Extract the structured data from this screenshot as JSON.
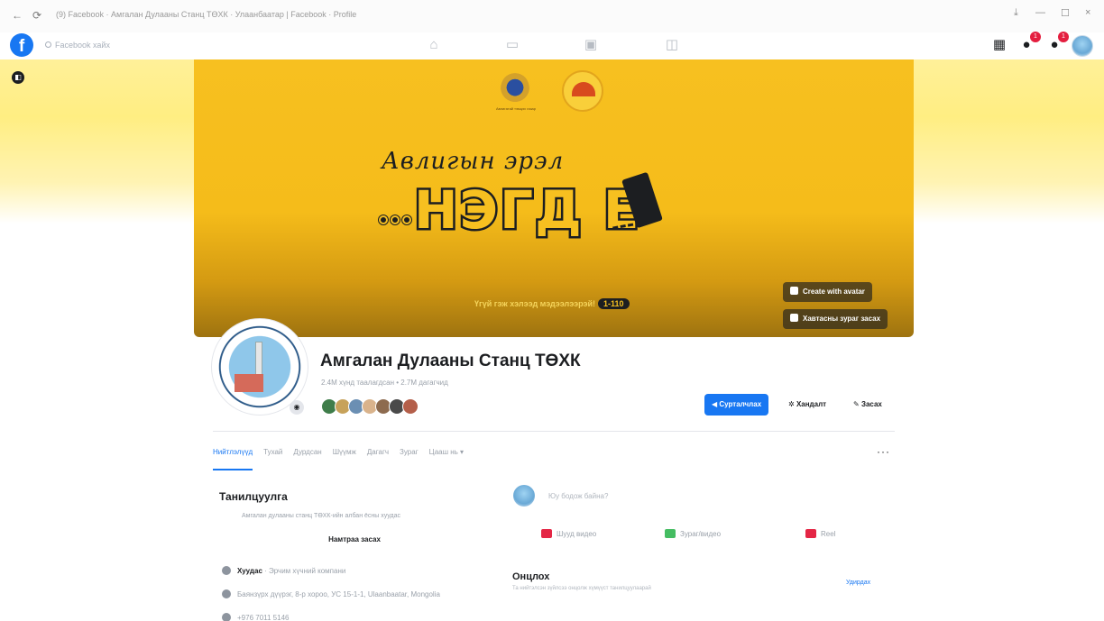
{
  "browser": {
    "back": "←",
    "reload": "⟳",
    "tab_title": "(9) Facebook · Амгалан Дулааны Станц ТӨХК · Улаанбаатар | Facebook · Profile",
    "win_download": "⤓",
    "win_min": "—",
    "win_max": "☐",
    "win_close": "×"
  },
  "topnav": {
    "logo": "f",
    "search_placeholder": "Facebook хайх",
    "nav_icons": [
      "home-icon",
      "video-icon",
      "marketplace-icon",
      "groups-icon"
    ],
    "menu_glyph": "▦",
    "messenger_badge": "1",
    "notifications_badge": "1"
  },
  "cover": {
    "toggle_glyph": "◧",
    "emblem_caption": "Авлигатай тэмцэх газар",
    "script_line": "Авлигын эрэл",
    "big_word": "НЭГД E",
    "hotline_text": "Үгүй гэж хэлээд мэдээлээрэй!",
    "hotline_number": "1-110",
    "create_avatar_label": "Create with avatar",
    "edit_cover_label": "Хавтасны зураг засах"
  },
  "profile": {
    "name": "Амгалан Дулааны Станц ТӨХК",
    "stats": "2.4М хүнд таалагдсан • 2.7М дагагчид",
    "camera_glyph": "◉",
    "friend_colors": [
      "#3f7d4a",
      "#c7a25a",
      "#6b8fb3",
      "#d9b38c",
      "#8d6b4f",
      "#4a4a4a",
      "#b45f4a"
    ]
  },
  "actions": {
    "promote_label": "Сурталчлах",
    "insights_label": "Хандалт",
    "edit_label": "Засах"
  },
  "tabs": {
    "items": [
      "Нийтлэлүүд",
      "Тухай",
      "Дурдсан",
      "Шүүмж",
      "Дагагч",
      "Зураг",
      "Цааш нь ▾"
    ],
    "more_glyph": "···"
  },
  "intro": {
    "title": "Танилцуулга",
    "bio": "Амгалан дулааны станц ТӨХК-ийн албан ёсны хуудас",
    "edit_bio_label": "Намтраа засах",
    "category_label": "Хуудас",
    "category_value": "Эрчим хүчний компани",
    "address": "Баянзүрх дүүрэг, 8-р хороо, УС 15-1-1, Ulaanbaatar, Mongolia",
    "phone": "+976 7011 5146"
  },
  "composer": {
    "placeholder": "Юу бодож байна?",
    "live_label": "Шууд видео",
    "photo_label": "Зураг/видео",
    "reel_label": "Reel",
    "colors": {
      "live": "#e42645",
      "photo": "#45bd62",
      "reel": "#e42645"
    }
  },
  "featured": {
    "title": "Онцлох",
    "subtitle": "Та нийтэлсэн зүйлсээ онцолж хүмүүст танилцуулаарай",
    "manage_label": "Удирдах"
  }
}
